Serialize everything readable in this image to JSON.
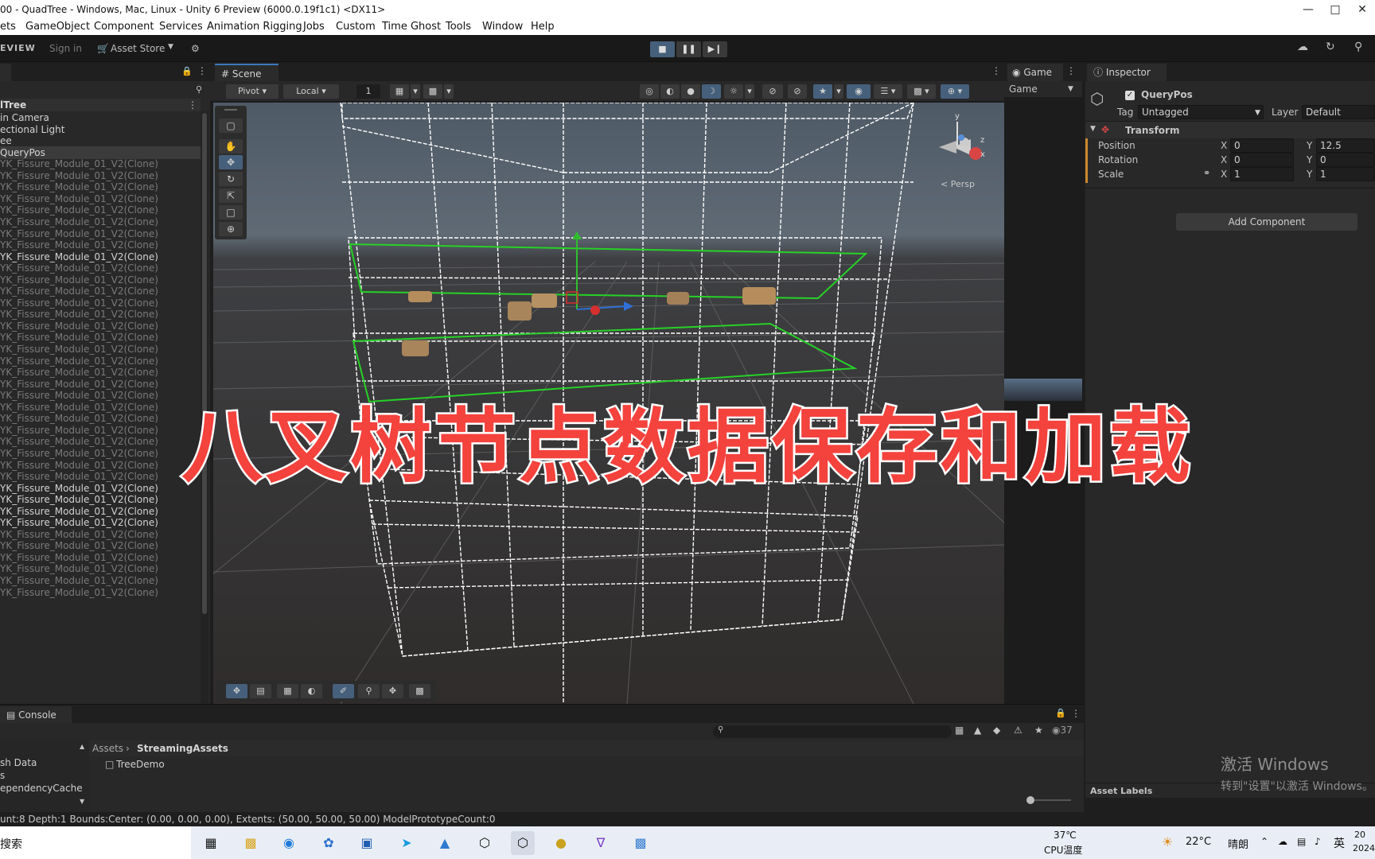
{
  "window": {
    "title": "00 - QuadTree - Windows, Mac, Linux - Unity 6 Preview (6000.0.19f1c1) <DX11>"
  },
  "menu": [
    "ets",
    "GameObject",
    "Component",
    "Services",
    "Animation Rigging",
    "Jobs",
    "Custom",
    "Time Ghost",
    "Tools",
    "Window",
    "Help"
  ],
  "toolbar": {
    "preview_label": "EVIEW",
    "signin_label": "Sign in",
    "asset_store_label": "Asset Store"
  },
  "hierarchy": {
    "root": "lTree",
    "items": [
      {
        "label": "in Camera",
        "style": "white"
      },
      {
        "label": "ectional Light",
        "style": "white"
      },
      {
        "label": "ee",
        "style": "white"
      },
      {
        "label": "QueryPos",
        "style": "sel"
      },
      {
        "label": "YK_Fissure_Module_01_V2(Clone)",
        "style": "dim"
      },
      {
        "label": "YK_Fissure_Module_01_V2(Clone)",
        "style": "dim"
      },
      {
        "label": "YK_Fissure_Module_01_V2(Clone)",
        "style": "dim"
      },
      {
        "label": "YK_Fissure_Module_01_V2(Clone)",
        "style": "dim"
      },
      {
        "label": "YK_Fissure_Module_01_V2(Clone)",
        "style": "dim"
      },
      {
        "label": "YK_Fissure_Module_01_V2(Clone)",
        "style": "dim"
      },
      {
        "label": "YK_Fissure_Module_01_V2(Clone)",
        "style": "dim"
      },
      {
        "label": "YK_Fissure_Module_01_V2(Clone)",
        "style": "dim"
      },
      {
        "label": "YK_Fissure_Module_01_V2(Clone)",
        "style": "white"
      },
      {
        "label": "YK_Fissure_Module_01_V2(Clone)",
        "style": "dim"
      },
      {
        "label": "YK_Fissure_Module_01_V2(Clone)",
        "style": "dim"
      },
      {
        "label": "YK_Fissure_Module_01_V2(Clone)",
        "style": "dim"
      },
      {
        "label": "YK_Fissure_Module_01_V2(Clone)",
        "style": "dim"
      },
      {
        "label": "YK_Fissure_Module_01_V2(Clone)",
        "style": "dim"
      },
      {
        "label": "YK_Fissure_Module_01_V2(Clone)",
        "style": "dim"
      },
      {
        "label": "YK_Fissure_Module_01_V2(Clone)",
        "style": "dim"
      },
      {
        "label": "YK_Fissure_Module_01_V2(Clone)",
        "style": "dim"
      },
      {
        "label": "YK_Fissure_Module_01_V2(Clone)",
        "style": "dim"
      },
      {
        "label": "YK_Fissure_Module_01_V2(Clone)",
        "style": "dim"
      },
      {
        "label": "YK_Fissure_Module_01_V2(Clone)",
        "style": "dim"
      },
      {
        "label": "YK_Fissure_Module_01_V2(Clone)",
        "style": "dim"
      },
      {
        "label": "YK_Fissure_Module_01_V2(Clone)",
        "style": "dim"
      },
      {
        "label": "YK_Fissure_Module_01_V2(Clone)",
        "style": "dim"
      },
      {
        "label": "YK_Fissure_Module_01_V2(Clone)",
        "style": "dim"
      },
      {
        "label": "YK_Fissure_Module_01_V2(Clone)",
        "style": "dim"
      },
      {
        "label": "YK_Fissure_Module_01_V2(Clone)",
        "style": "dim"
      },
      {
        "label": "YK_Fissure_Module_01_V2(Clone)",
        "style": "dim"
      },
      {
        "label": "YK_Fissure_Module_01_V2(Clone)",
        "style": "dim"
      },
      {
        "label": "YK_Fissure_Module_01_V2(Clone)",
        "style": "white"
      },
      {
        "label": "YK_Fissure_Module_01_V2(Clone)",
        "style": "white"
      },
      {
        "label": "YK_Fissure_Module_01_V2(Clone)",
        "style": "white"
      },
      {
        "label": "YK_Fissure_Module_01_V2(Clone)",
        "style": "white"
      },
      {
        "label": "YK_Fissure_Module_01_V2(Clone)",
        "style": "dim"
      },
      {
        "label": "YK_Fissure_Module_01_V2(Clone)",
        "style": "dim"
      },
      {
        "label": "YK_Fissure_Module_01_V2(Clone)",
        "style": "dim"
      },
      {
        "label": "YK_Fissure_Module_01_V2(Clone)",
        "style": "dim"
      },
      {
        "label": "YK_Fissure_Module_01_V2(Clone)",
        "style": "dim"
      },
      {
        "label": "YK_Fissure_Module_01_V2(Clone)",
        "style": "dim"
      }
    ]
  },
  "scene": {
    "tab_label": "Scene",
    "pivot_label": "Pivot",
    "local_label": "Local",
    "grid_value": "1",
    "persp_label": "< Persp",
    "gizmo_axes": {
      "x": "x",
      "y": "y",
      "z": "z"
    }
  },
  "game": {
    "tab_label": "Game",
    "dropdown_label": "Game"
  },
  "inspector": {
    "tab_label": "Inspector",
    "object_name": "QueryPos",
    "tag_label": "Tag",
    "tag_value": "Untagged",
    "layer_label": "Layer",
    "layer_value": "Default",
    "transform_label": "Transform",
    "position_label": "Position",
    "rotation_label": "Rotation",
    "scale_label": "Scale",
    "x_label": "X",
    "y_label": "Y",
    "position": {
      "x": "0",
      "y": "12.5"
    },
    "rotation": {
      "x": "0",
      "y": "0"
    },
    "scale": {
      "x": "1",
      "y": "1"
    },
    "add_component_label": "Add Component",
    "asset_labels": "Asset Labels"
  },
  "console": {
    "tab_label": "Console",
    "count": "37",
    "breadcrumb_root": "Assets",
    "breadcrumb_current": "StreamingAssets",
    "files": [
      "TreeDemo"
    ],
    "left_items": [
      "sh Data",
      "s",
      "ependencyCache"
    ]
  },
  "status": {
    "text": "unt:8  Depth:1 Bounds:Center: (0.00, 0.00, 0.00), Extents: (50.00, 50.00, 50.00) ModelPrototypeCount:0"
  },
  "overlay": {
    "caption": "八叉树节点数据保存和加载"
  },
  "watermark": {
    "line1": "激活 Windows",
    "line2": "转到\"设置\"以激活 Windows。"
  },
  "taskbar": {
    "search_label": "搜索",
    "cpu_temp": "37℃",
    "cpu_label": "CPU温度",
    "weather_temp": "22°C",
    "weather_text": "晴朗",
    "ime_label": "英",
    "clock_line1": "20",
    "clock_line2": "2024"
  }
}
